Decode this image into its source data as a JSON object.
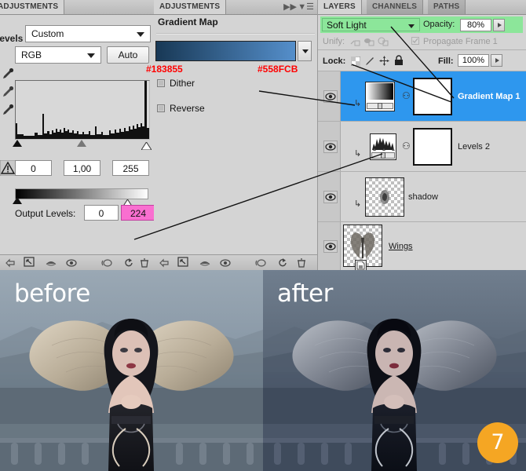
{
  "adjustments_left": {
    "tab_label": "ADJUSTMENTS",
    "panel_title": "Levels",
    "preset": "Custom",
    "channel": "RGB",
    "auto_button": "Auto",
    "input_black": "0",
    "input_gamma": "1,00",
    "input_white": "255",
    "output_label": "Output Levels:",
    "output_black": "0",
    "output_white": "224",
    "icons": {
      "eyedropper_black": "eyedropper-black-icon",
      "eyedropper_gray": "eyedropper-gray-icon",
      "eyedropper_white": "eyedropper-white-icon",
      "warning": "warning-triangle-icon",
      "collapse": "collapse-icon",
      "menu": "panel-menu-icon"
    },
    "footer_icons": [
      "return-arrow-icon",
      "clip-to-layer-icon",
      "eye-preview-icon",
      "eye-icon",
      "reset-icon",
      "delete-icon"
    ]
  },
  "adjustments_right": {
    "tab_label": "ADJUSTMENTS",
    "panel_title": "Gradient Map",
    "gradient_start_hex": "#183855",
    "gradient_end_hex": "#558FCB",
    "dither_label": "Dither",
    "reverse_label": "Reverse",
    "dither_checked": false,
    "reverse_checked": false,
    "footer_icons": [
      "return-arrow-icon",
      "clip-to-layer-icon",
      "eye-preview-icon",
      "eye-icon",
      "reset-icon",
      "refresh-icon",
      "delete-icon"
    ]
  },
  "layers_panel": {
    "tabs": [
      {
        "label": "LAYERS",
        "active": true
      },
      {
        "label": "CHANNELS",
        "active": false
      },
      {
        "label": "PATHS",
        "active": false
      }
    ],
    "blend_mode": "Soft Light",
    "opacity_label": "Opacity:",
    "opacity_value": "80%",
    "unify_label": "Unify:",
    "propagate_label": "Propagate Frame 1",
    "lock_label": "Lock:",
    "fill_label": "Fill:",
    "fill_value": "100%",
    "highlight_color": "#8ce69a",
    "selected_row_color": "#2e97ee",
    "layers": [
      {
        "name": "Gradient Map 1",
        "selected": true,
        "underlined": false,
        "thumb": "gradient-thumb",
        "has_mask": true,
        "clipped": true
      },
      {
        "name": "Levels 2",
        "selected": false,
        "underlined": false,
        "thumb": "levels-thumb",
        "has_mask": true,
        "clipped": true
      },
      {
        "name": "shadow",
        "selected": false,
        "underlined": false,
        "thumb": "shadow-thumb",
        "has_mask": false,
        "clipped": true
      },
      {
        "name": "Wings",
        "selected": false,
        "underlined": true,
        "thumb": "wings-thumb",
        "has_mask": false,
        "clipped": false
      }
    ]
  },
  "comparison": {
    "before_label": "before",
    "after_label": "after",
    "step_badge": "7",
    "badge_color": "#f5a623"
  }
}
